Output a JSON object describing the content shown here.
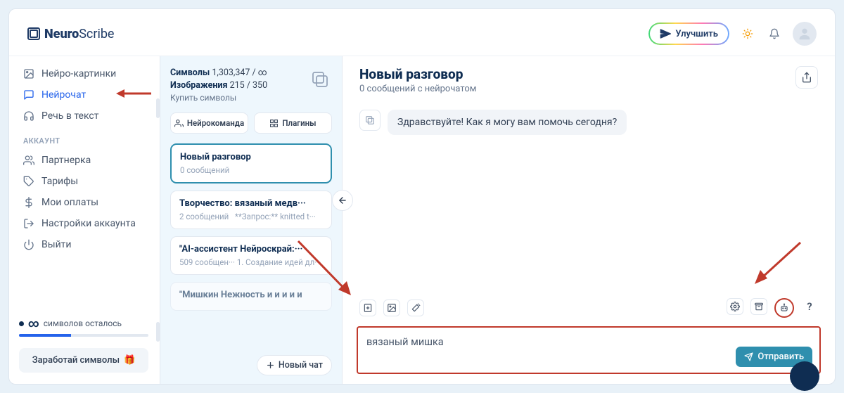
{
  "app_name_strong": "Neuro",
  "app_name_thin": "Scribe",
  "improve_label": "Улучшить",
  "sidebar": {
    "items": [
      {
        "label": "Нейро-картинки"
      },
      {
        "label": "Нейрочат"
      },
      {
        "label": "Речь в текст"
      }
    ],
    "account_label": "АККАУНТ",
    "account_items": [
      {
        "label": "Партнерка"
      },
      {
        "label": "Тарифы"
      },
      {
        "label": "Мои оплаты"
      },
      {
        "label": "Настройки аккаунта"
      },
      {
        "label": "Выйти"
      }
    ],
    "symbols_left_label": "символов осталось",
    "earn_label": "Заработай символы"
  },
  "mid": {
    "symbols_label": "Символы",
    "symbols_value": "1,303,347 / ∞",
    "images_label": "Изображения",
    "images_value": "215 / 350",
    "buy_label": "Купить символы",
    "team_label": "Нейрокоманда",
    "plugins_label": "Плагины",
    "conversations": [
      {
        "title": "Новый разговор",
        "sub": "0 сообщений"
      },
      {
        "title": "Творчество: вязаный медв···",
        "sub": "2 сообщений   **Запрос:** knitted t···"
      },
      {
        "title": "\"AI-ассистент Нейроскрай:···",
        "sub": "509 сообщен··· 1. Создание идей дл···"
      },
      {
        "title": "\"Мишкин Нежность и и и и и"
      }
    ],
    "new_chat_label": "Новый чат"
  },
  "chat": {
    "title": "Новый разговор",
    "sub": "0 сообщений с нейрочатом",
    "greeting": "Здравствуйте! Как я могу вам помочь сегодня?",
    "input_value": "вязаный мишка",
    "send_label": "Отправить",
    "question_mark": "?"
  }
}
